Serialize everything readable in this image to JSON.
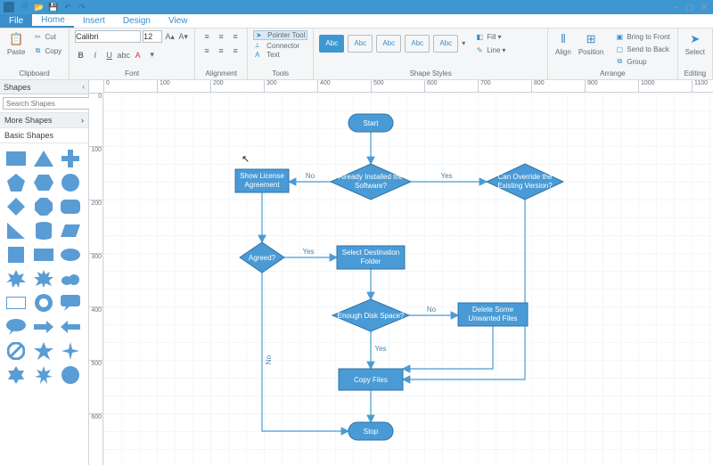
{
  "titlebar": {
    "qat": [
      "new",
      "open",
      "save"
    ],
    "win": [
      "min",
      "max",
      "close"
    ]
  },
  "tabs": {
    "file": "File",
    "items": [
      "Home",
      "Insert",
      "Design",
      "View"
    ],
    "active": "Home"
  },
  "ribbon": {
    "clipboard": {
      "label": "Clipboard",
      "paste": "Paste",
      "cut": "Cut",
      "copy": "Copy"
    },
    "font": {
      "label": "Font",
      "name": "Calibri",
      "size": "12"
    },
    "alignment": {
      "label": "Alignment"
    },
    "tools": {
      "label": "Tools",
      "pointer": "Pointer Tool",
      "connector": "Connector",
      "text": "Text"
    },
    "styles": {
      "label": "Shape Styles",
      "swatches": [
        "Abc",
        "Abc",
        "Abc",
        "Abc",
        "Abc"
      ],
      "fill": "Fill",
      "line": "Line"
    },
    "arrange": {
      "label": "Arrange",
      "align": "Align",
      "position": "Position",
      "front": "Bring to Front",
      "back": "Send to Back",
      "group": "Group"
    },
    "editing": {
      "label": "Editing",
      "select": "Select"
    }
  },
  "shapes": {
    "header": "Shapes",
    "search_placeholder": "Search Shapes",
    "more": "More Shapes",
    "basic": "Basic Shapes"
  },
  "ruler": {
    "h": [
      "0",
      "100",
      "200",
      "300",
      "400",
      "500",
      "600",
      "700",
      "800",
      "900",
      "1000",
      "1100"
    ],
    "v": [
      "0",
      "100",
      "200",
      "300",
      "400",
      "500",
      "600"
    ]
  },
  "flow": {
    "nodes": {
      "start": "Start",
      "license1": "Show License",
      "license2": "Agreement",
      "installed1": "Already Installed the",
      "installed2": "Software?",
      "override1": "Can Override the",
      "override2": "Existing Version?",
      "agreed": "Agreed?",
      "dest1": "Select Destination",
      "dest2": "Folder",
      "disk": "Enough Disk Space?",
      "delete1": "Delete Some",
      "delete2": "Unwanted Files",
      "copy": "Copy Files",
      "stop": "Stop"
    },
    "labels": {
      "yes": "Yes",
      "no": "No"
    }
  },
  "chart_data": {
    "type": "flowchart",
    "nodes": [
      {
        "id": "start",
        "kind": "terminator",
        "label": "Start"
      },
      {
        "id": "license",
        "kind": "process",
        "label": "Show License Agreement"
      },
      {
        "id": "installed",
        "kind": "decision",
        "label": "Already Installed the Software?"
      },
      {
        "id": "override",
        "kind": "decision",
        "label": "Can Override the Existing Version?"
      },
      {
        "id": "agreed",
        "kind": "decision",
        "label": "Agreed?"
      },
      {
        "id": "dest",
        "kind": "process",
        "label": "Select Destination Folder"
      },
      {
        "id": "disk",
        "kind": "decision",
        "label": "Enough Disk Space?"
      },
      {
        "id": "delete",
        "kind": "process",
        "label": "Delete Some Unwanted Files"
      },
      {
        "id": "copy",
        "kind": "process",
        "label": "Copy Files"
      },
      {
        "id": "stop",
        "kind": "terminator",
        "label": "Stop"
      }
    ],
    "edges": [
      {
        "from": "start",
        "to": "installed",
        "label": ""
      },
      {
        "from": "installed",
        "to": "license",
        "label": "No"
      },
      {
        "from": "installed",
        "to": "override",
        "label": "Yes"
      },
      {
        "from": "license",
        "to": "agreed",
        "label": ""
      },
      {
        "from": "agreed",
        "to": "dest",
        "label": "Yes"
      },
      {
        "from": "agreed",
        "to": "stop",
        "label": "No"
      },
      {
        "from": "dest",
        "to": "disk",
        "label": ""
      },
      {
        "from": "disk",
        "to": "delete",
        "label": "No"
      },
      {
        "from": "disk",
        "to": "copy",
        "label": "Yes"
      },
      {
        "from": "delete",
        "to": "copy",
        "label": ""
      },
      {
        "from": "override",
        "to": "copy",
        "label": ""
      },
      {
        "from": "copy",
        "to": "stop",
        "label": ""
      }
    ]
  }
}
